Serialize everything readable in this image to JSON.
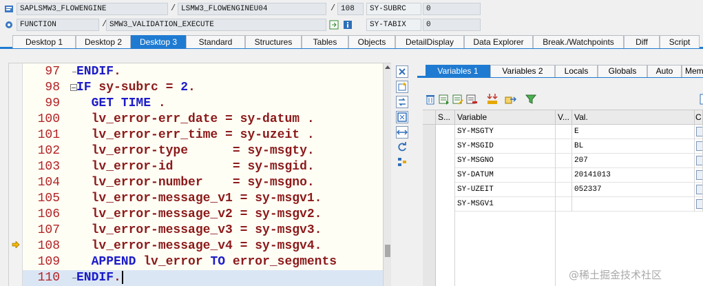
{
  "header": {
    "row1": {
      "program": "SAPLSMW3_FLOWENGINE",
      "include": "LSMW3_FLOWENGINEU04",
      "line": "108",
      "sysfield": "SY-SUBRC",
      "sysvalue": "0",
      "sep": "/"
    },
    "row2": {
      "type": "FUNCTION",
      "name": "SMW3_VALIDATION_EXECUTE",
      "sysfield": "SY-TABIX",
      "sysvalue": "0",
      "sep": "/"
    }
  },
  "desktop_tabs": [
    "Desktop 1",
    "Desktop 2",
    "Desktop 3",
    "Standard",
    "Structures",
    "Tables",
    "Objects",
    "DetailDisplay",
    "Data Explorer",
    "Break./Watchpoints",
    "Diff",
    "Script"
  ],
  "active_tab": "Desktop 3",
  "code": {
    "lines": [
      {
        "no": "97",
        "t": [
          [
            "kw",
            "ENDIF"
          ],
          [
            "op",
            "."
          ]
        ]
      },
      {
        "no": "98",
        "t": [
          [
            "kw",
            "IF "
          ],
          [
            "vr",
            "sy-subrc"
          ],
          [
            "op",
            " = "
          ],
          [
            "num",
            "2"
          ],
          [
            "op",
            "."
          ]
        ]
      },
      {
        "no": "99",
        "t": [
          [
            "kw",
            "  GET TIME "
          ],
          [
            "op",
            "."
          ]
        ]
      },
      {
        "no": "100",
        "t": [
          [
            "vr",
            "  lv_error-err_date"
          ],
          [
            "op",
            " = "
          ],
          [
            "vr",
            "sy-datum"
          ],
          [
            "op",
            " ."
          ]
        ]
      },
      {
        "no": "101",
        "t": [
          [
            "vr",
            "  lv_error-err_time"
          ],
          [
            "op",
            " = "
          ],
          [
            "vr",
            "sy-uzeit"
          ],
          [
            "op",
            " ."
          ]
        ]
      },
      {
        "no": "102",
        "t": [
          [
            "vr",
            "  lv_error-type     "
          ],
          [
            "op",
            " = "
          ],
          [
            "vr",
            "sy-msgty"
          ],
          [
            "op",
            "."
          ]
        ]
      },
      {
        "no": "103",
        "t": [
          [
            "vr",
            "  lv_error-id       "
          ],
          [
            "op",
            " = "
          ],
          [
            "vr",
            "sy-msgid"
          ],
          [
            "op",
            "."
          ]
        ]
      },
      {
        "no": "104",
        "t": [
          [
            "vr",
            "  lv_error-number   "
          ],
          [
            "op",
            " = "
          ],
          [
            "vr",
            "sy-msgno"
          ],
          [
            "op",
            "."
          ]
        ]
      },
      {
        "no": "105",
        "t": [
          [
            "vr",
            "  lv_error-message_v1"
          ],
          [
            "op",
            " = "
          ],
          [
            "vr",
            "sy-msgv1"
          ],
          [
            "op",
            "."
          ]
        ]
      },
      {
        "no": "106",
        "t": [
          [
            "vr",
            "  lv_error-message_v2"
          ],
          [
            "op",
            " = "
          ],
          [
            "vr",
            "sy-msgv2"
          ],
          [
            "op",
            "."
          ]
        ]
      },
      {
        "no": "107",
        "t": [
          [
            "vr",
            "  lv_error-message_v3"
          ],
          [
            "op",
            " = "
          ],
          [
            "vr",
            "sy-msgv3"
          ],
          [
            "op",
            "."
          ]
        ]
      },
      {
        "no": "108",
        "t": [
          [
            "vr",
            "  lv_error-message_v4"
          ],
          [
            "op",
            " = "
          ],
          [
            "vr",
            "sy-msgv4"
          ],
          [
            "op",
            "."
          ]
        ]
      },
      {
        "no": "109",
        "t": [
          [
            "kw",
            "  APPEND "
          ],
          [
            "vr",
            "lv_error"
          ],
          [
            "kw",
            " TO "
          ],
          [
            "vr",
            "error_segments"
          ]
        ]
      },
      {
        "no": "110",
        "t": [
          [
            "kw",
            "ENDIF"
          ],
          [
            "op",
            "."
          ]
        ]
      }
    ],
    "execution_line": "108",
    "current_line": "110"
  },
  "variables": {
    "tabs": [
      "Variables 1",
      "Variables 2",
      "Locals",
      "Globals",
      "Auto",
      "Memo"
    ],
    "active_tab": "Variables 1",
    "columns": [
      "S...",
      "Variable",
      "V...",
      "Val.",
      "C"
    ],
    "rows": [
      {
        "variable": "SY-MSGTY",
        "value": "E"
      },
      {
        "variable": "SY-MSGID",
        "value": "BL"
      },
      {
        "variable": "SY-MSGNO",
        "value": "207"
      },
      {
        "variable": "SY-DATUM",
        "value": "20141013"
      },
      {
        "variable": "SY-UZEIT",
        "value": "052337"
      },
      {
        "variable": "SY-MSGV1",
        "value": ""
      }
    ]
  },
  "colors": {
    "accent": "#1f7bd1",
    "keyword": "#1c1cc8",
    "variable": "#8b1a1a",
    "line_number": "#b22222"
  },
  "watermark": "@稀土掘金技术社区"
}
